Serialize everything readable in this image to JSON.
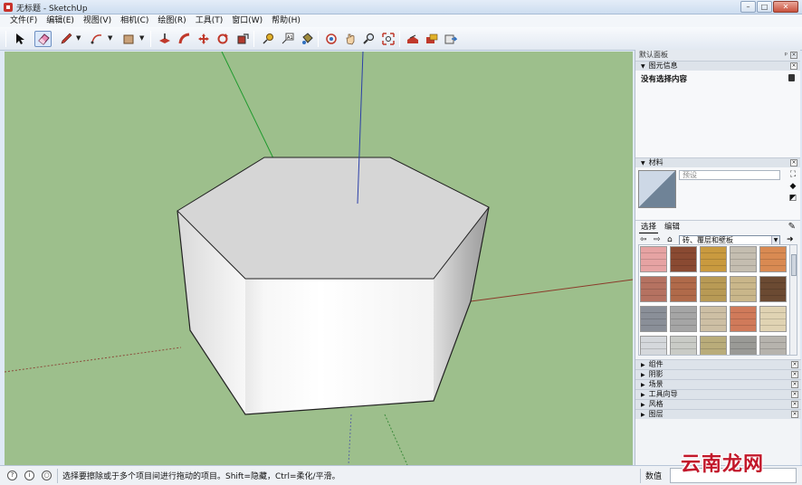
{
  "window": {
    "title": "无标题 - SketchUp",
    "controls": [
      "–",
      "□",
      "✕"
    ]
  },
  "menu": [
    "文件(F)",
    "编辑(E)",
    "视图(V)",
    "相机(C)",
    "绘图(R)",
    "工具(T)",
    "窗口(W)",
    "帮助(H)"
  ],
  "toolbar": {
    "icons": [
      "select-arrow-icon",
      "eraser-icon",
      "pencil-icon",
      "arc-icon",
      "shape-icon",
      "pushpull-icon",
      "followme-icon",
      "move-icon",
      "rotate-icon",
      "scale-icon",
      "tape-measure-icon",
      "text-icon",
      "paint-bucket-icon",
      "orbit-icon",
      "pan-icon",
      "zoom-icon",
      "zoom-extents-icon",
      "warehouse-icon",
      "share-model-icon",
      "extension-icon"
    ],
    "active": "eraser-icon"
  },
  "tray": {
    "title": "默认面板",
    "entity_info": {
      "header": "图元信息",
      "selection": "没有选择内容"
    },
    "materials": {
      "header": "材料",
      "name_placeholder": "预设",
      "tabs": [
        "选择",
        "编辑"
      ],
      "library": "砖、覆层和壁板",
      "textures": [
        "#e6a3a3",
        "#8a4a32",
        "#c99a3f",
        "#c4bdb0",
        "#d98a52",
        "#b57261",
        "#b06a4a",
        "#b89a55",
        "#c9b68a",
        "#6b4a32",
        "#8a8f98",
        "#a5a5a5",
        "#cdbfa4",
        "#d07a5a",
        "#e0d3b3",
        "#d5d8dc",
        "#c9cbc6",
        "#b9ac7a",
        "#9a9a96",
        "#b6b3ad"
      ]
    },
    "collapsed_sections": [
      "组件",
      "阴影",
      "场景",
      "工具向导",
      "风格",
      "图层"
    ]
  },
  "status": {
    "message": "选择要擦除或于多个项目间进行拖动的项目。Shift=隐藏，Ctrl=柔化/平滑。",
    "value_label": "数值",
    "value": ""
  },
  "watermark": "云南龙网"
}
